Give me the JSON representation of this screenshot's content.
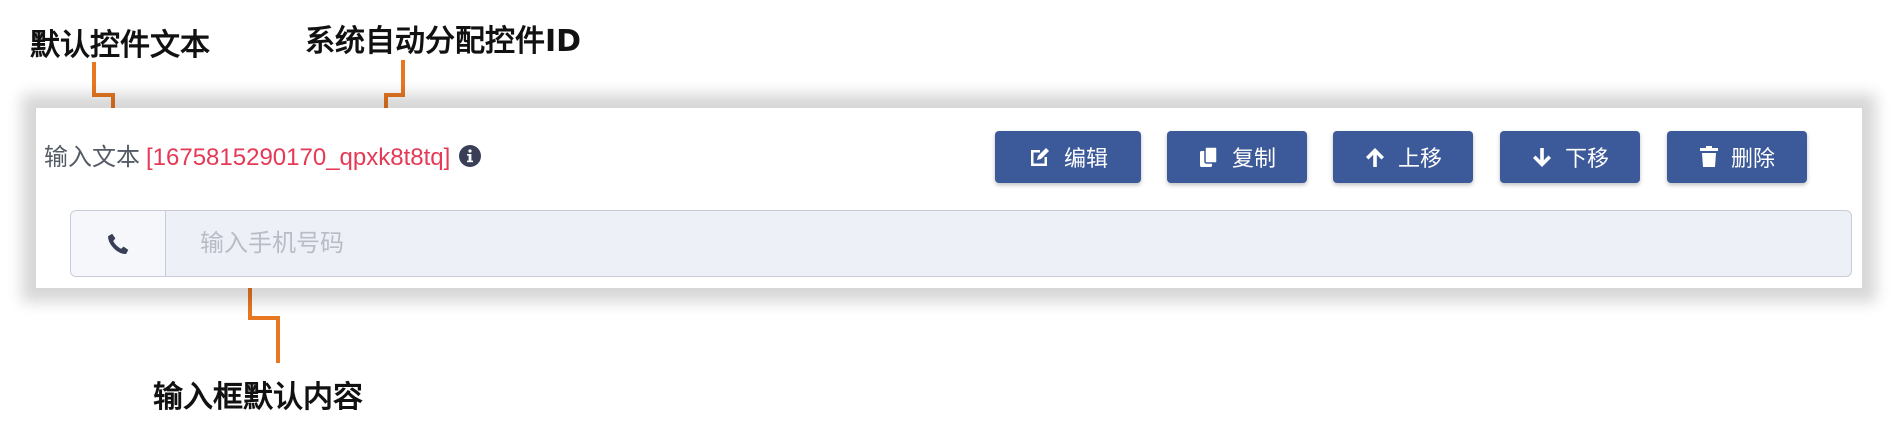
{
  "annotations": {
    "control_text": "默认控件文本",
    "control_id": "系统自动分配控件ID",
    "input_default": "输入框默认内容"
  },
  "field": {
    "label": "输入文本",
    "id": "[1675815290170_qpxk8t8tq]",
    "info_icon": "info-circle-icon",
    "input_placeholder": "输入手机号码",
    "addon_icon": "phone-icon"
  },
  "toolbar": {
    "edit_label": "编辑",
    "copy_label": "复制",
    "move_up_label": "上移",
    "move_down_label": "下移",
    "delete_label": "删除"
  },
  "colors": {
    "button_bg": "#3c5a99",
    "id_text": "#e53956",
    "arrow": "#e87722"
  }
}
